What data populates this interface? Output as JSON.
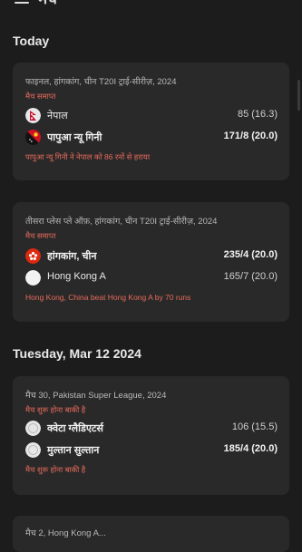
{
  "header": {
    "title": "मैच"
  },
  "sections": [
    {
      "heading": "Today"
    },
    {
      "heading": "Tuesday, Mar 12 2024"
    }
  ],
  "cards": [
    {
      "series": "फाइनल, हांगकांग, चीन T20I ट्राई-सीरीज़, 2024",
      "status": "मैच समाप्त",
      "teams": [
        {
          "name": "नेपाल",
          "score": "85 (16.3)",
          "flag_icon": "nepal-flag-icon"
        },
        {
          "name": "पापुआ न्यू गिनी",
          "score": "171/8 (20.0)",
          "flag_icon": "png-flag-icon"
        }
      ],
      "result": "पापुआ न्यू गिनी ने नेपाल को 86 रनों से हराया"
    },
    {
      "series": "तीसरा प्लेस प्ले ऑफ़, हांगकांग, चीन T20I ट्राई-सीरीज़, 2024",
      "status": "मैच समाप्त",
      "teams": [
        {
          "name": "हांगकांग, चीन",
          "score": "235/4 (20.0)",
          "flag_icon": "hong-kong-flag-icon"
        },
        {
          "name": "Hong Kong A",
          "score": "165/7 (20.0)",
          "flag_icon": "generic-team-icon"
        }
      ],
      "result": "Hong Kong, China beat Hong Kong A by 70 runs"
    },
    {
      "series": "मैच 30, Pakistan Super League, 2024",
      "status": "मैच शुरू होना बाकी है",
      "teams": [
        {
          "name": "क्वेटा ग्लैडिएटर्स",
          "score": "106 (15.5)",
          "flag_icon": "quetta-logo-icon"
        },
        {
          "name": "मुल्तान सुल्तान",
          "score": "185/4 (20.0)",
          "flag_icon": "multan-logo-icon"
        }
      ],
      "result": "मैच शुरू होना बाकी है"
    },
    {
      "series": "मैच 2, Hong Kong A...",
      "status": "",
      "teams": [],
      "result": ""
    }
  ],
  "colors": {
    "background": "#1d1c1c",
    "card": "#2a2929",
    "accent_red": "#e56b5c",
    "nepal_red": "#c8102e",
    "hk_red": "#de2910"
  }
}
